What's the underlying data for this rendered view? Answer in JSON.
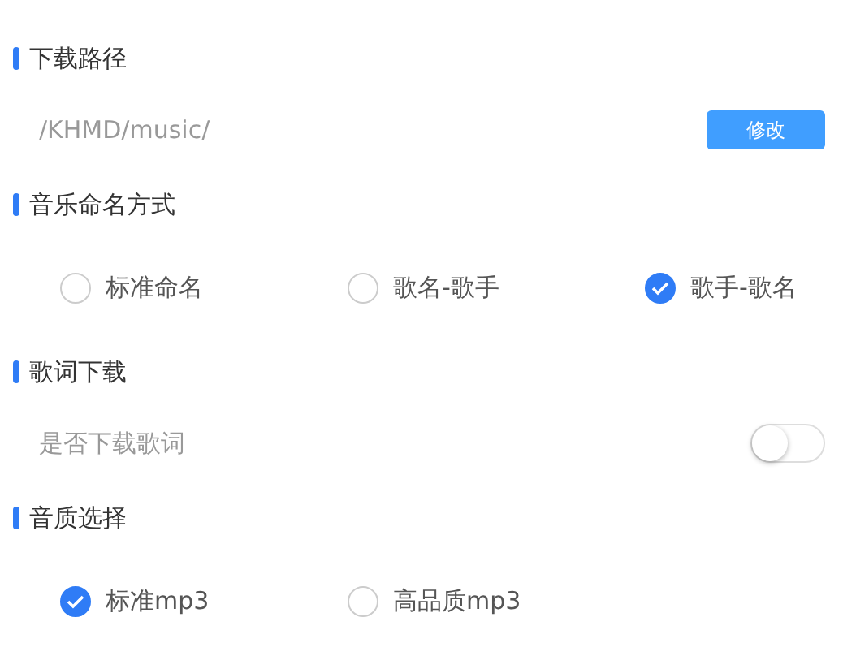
{
  "sections": [
    {
      "kind": "path",
      "title": "下载路径",
      "path": "/KHMD/music/",
      "button": "修改"
    },
    {
      "kind": "radios",
      "title": "音乐命名方式",
      "options": [
        {
          "label": "标准命名",
          "selected": false
        },
        {
          "label": "歌名-歌手",
          "selected": false
        },
        {
          "label": "歌手-歌名",
          "selected": true
        }
      ]
    },
    {
      "kind": "toggle",
      "title": "歌词下载",
      "label": "是否下载歌词",
      "on": false
    },
    {
      "kind": "radios",
      "title": "音质选择",
      "options": [
        {
          "label": "标准mp3",
          "selected": true
        },
        {
          "label": "高品质mp3",
          "selected": false
        }
      ]
    }
  ]
}
